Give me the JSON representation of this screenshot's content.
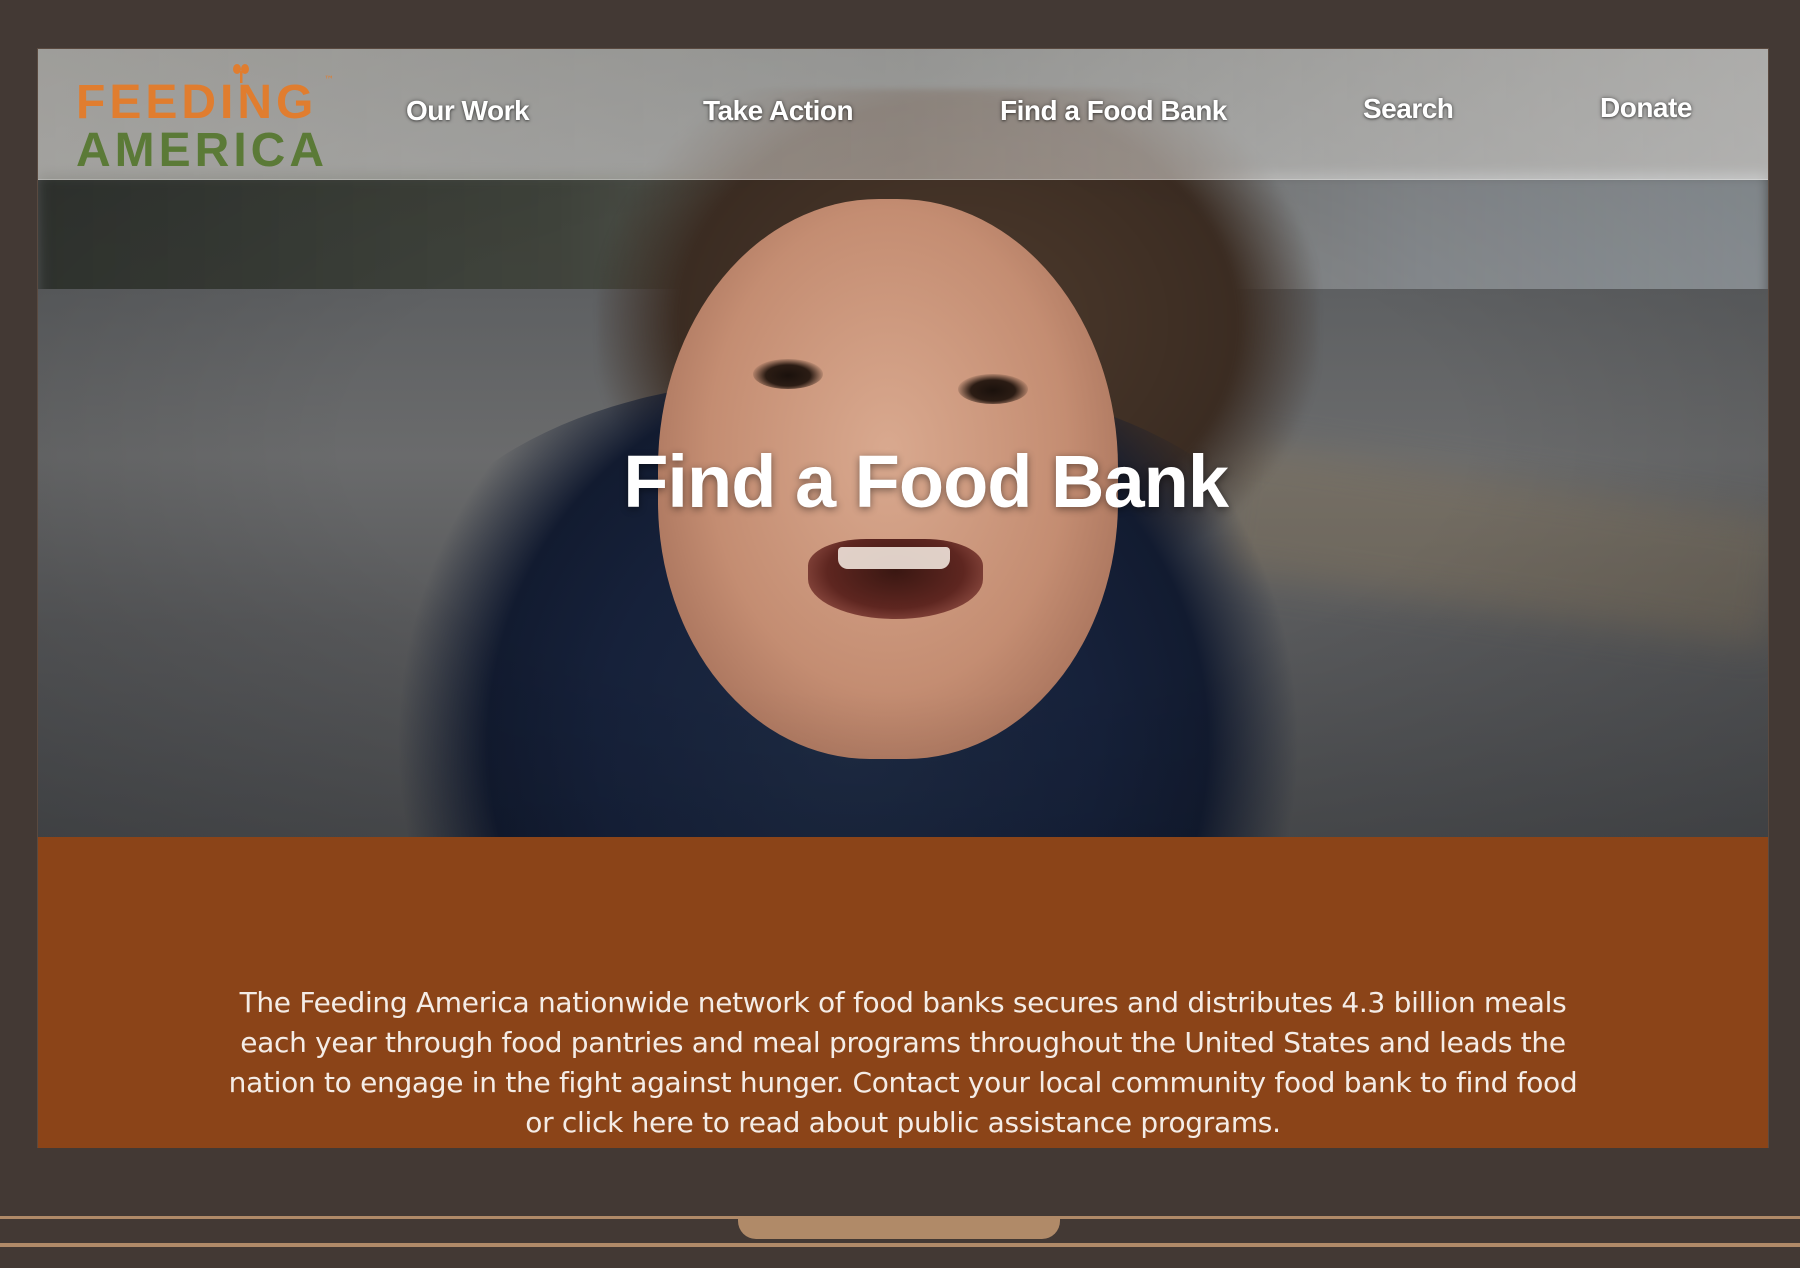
{
  "logo": {
    "line1": "FEEDING",
    "line2": "AMERICA",
    "trademark": "™",
    "colors": {
      "orange": "#e07d2f",
      "green": "#5b7a37"
    }
  },
  "nav": {
    "items": [
      {
        "label": "Our Work"
      },
      {
        "label": "Take Action"
      },
      {
        "label": "Find a Food Bank"
      },
      {
        "label": "Search"
      },
      {
        "label": "Donate"
      }
    ]
  },
  "hero": {
    "title": "Find a Food  Bank",
    "image": "smiling-child-in-hooded-jacket"
  },
  "content": {
    "text": "The Feeding America nationwide network of food banks secures and distributes 4.3 billion meals each year through food pantries and meal programs throughout the United States and leads the nation to engage in the fight against hunger. Contact your local community food bank to find food or click here to read about public assistance programs.",
    "background": "#8b4418"
  },
  "frame": {
    "color": "#433934",
    "accent": "#b08a68"
  }
}
